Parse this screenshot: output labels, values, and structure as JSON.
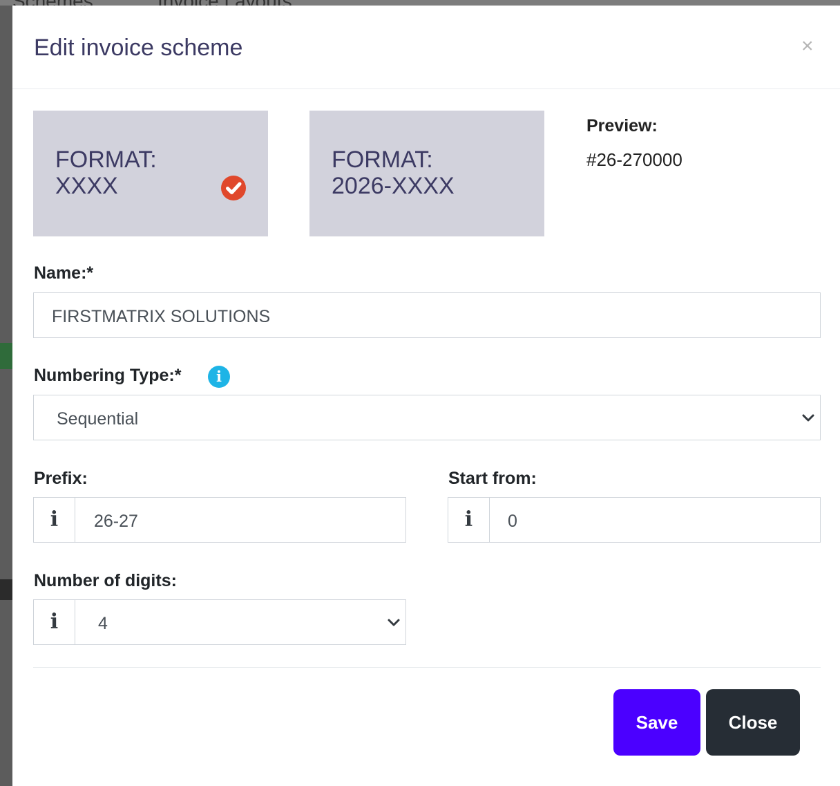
{
  "background": {
    "tabs": [
      "Schemes",
      "Invoice Layouts"
    ]
  },
  "modal": {
    "title": "Edit invoice scheme",
    "close_glyph": "×",
    "formats": [
      {
        "label": "FORMAT:",
        "value": "XXXX",
        "selected": true
      },
      {
        "label": "FORMAT:",
        "value": "2026-XXXX",
        "selected": false
      }
    ],
    "preview": {
      "label": "Preview:",
      "value": "#26-270000"
    },
    "name": {
      "label": "Name:*",
      "value": "FIRSTMATRIX SOLUTIONS"
    },
    "numbering_type": {
      "label": "Numbering Type:*",
      "value": "Sequential",
      "info_icon": "info-icon"
    },
    "prefix": {
      "label": "Prefix:",
      "addon": "i",
      "value": "26-27"
    },
    "start_from": {
      "label": "Start from:",
      "addon": "i",
      "value": "0"
    },
    "digits": {
      "label": "Number of digits:",
      "addon": "i",
      "value": "4"
    },
    "buttons": {
      "save": "Save",
      "close": "Close"
    }
  },
  "colors": {
    "accent": "#4b00ff",
    "dark_button": "#262d35",
    "check": "#e0482c",
    "info": "#1eb4e6",
    "card": "#d2d2dc"
  }
}
